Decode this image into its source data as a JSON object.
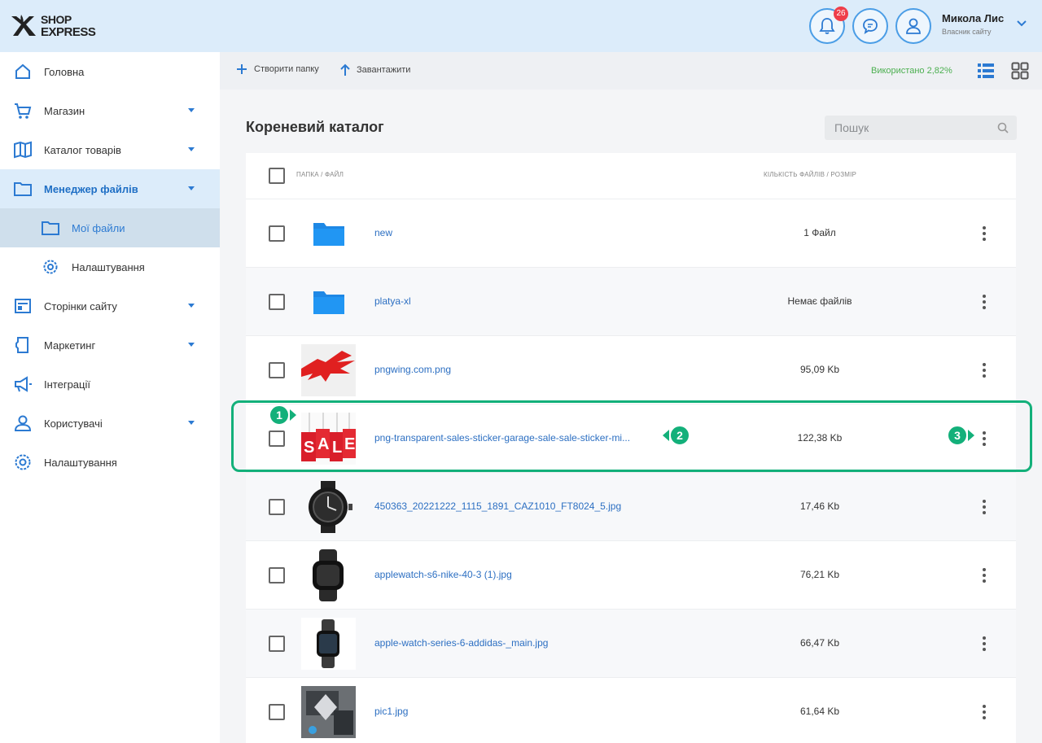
{
  "header": {
    "logo_line1": "SHOP",
    "logo_line2": "EXPRESS",
    "notifications_count": "26",
    "user_name": "Микола Лис",
    "user_role": "Власник сайту"
  },
  "sidebar": {
    "items": [
      {
        "label": "Головна",
        "icon": "home-icon"
      },
      {
        "label": "Магазин",
        "icon": "cart-icon"
      },
      {
        "label": "Каталог товарів",
        "icon": "catalog-icon"
      },
      {
        "label": "Менеджер файлів",
        "icon": "folder-icon"
      },
      {
        "label": "Мої файли",
        "icon": "folder-icon"
      },
      {
        "label": "Налаштування",
        "icon": "gear-icon"
      },
      {
        "label": "Сторінки сайту",
        "icon": "pages-icon"
      },
      {
        "label": "Маркетинг",
        "icon": "marketing-icon"
      },
      {
        "label": "Інтеграції",
        "icon": "megaphone-icon"
      },
      {
        "label": "Користувачі",
        "icon": "users-icon"
      },
      {
        "label": "Налаштування",
        "icon": "gear-icon"
      }
    ]
  },
  "toolbar": {
    "create_folder": "Створити папку",
    "upload": "Завантажити",
    "used": "Використано 2,82%"
  },
  "main": {
    "title": "Кореневий каталог",
    "search_placeholder": "Пошук",
    "col_name": "Папка / файл",
    "col_size": "Кількість файлів / розмір",
    "rows": [
      {
        "name": "new",
        "size": "1 Файл",
        "type": "folder"
      },
      {
        "name": "platya-xl",
        "size": "Немає файлів",
        "type": "folder"
      },
      {
        "name": "pngwing.com.png",
        "size": "95,09 Kb",
        "type": "image"
      },
      {
        "name": "png-transparent-sales-sticker-garage-sale-sale-sticker-mi...",
        "size": "122,38 Kb",
        "type": "image"
      },
      {
        "name": "450363_20221222_1115_1891_CAZ1010_FT8024_5.jpg",
        "size": "17,46 Kb",
        "type": "image"
      },
      {
        "name": "applewatch-s6-nike-40-3 (1).jpg",
        "size": "76,21 Kb",
        "type": "image"
      },
      {
        "name": "apple-watch-series-6-addidas-_main.jpg",
        "size": "66,47 Kb",
        "type": "image"
      },
      {
        "name": "pic1.jpg",
        "size": "61,64 Kb",
        "type": "image"
      }
    ]
  },
  "markers": [
    "1",
    "2",
    "3"
  ],
  "colors": {
    "accent": "#2c6fc2",
    "highlight": "#13b07a",
    "header_bg": "#dcecfa",
    "badge": "#ef3e4a"
  }
}
